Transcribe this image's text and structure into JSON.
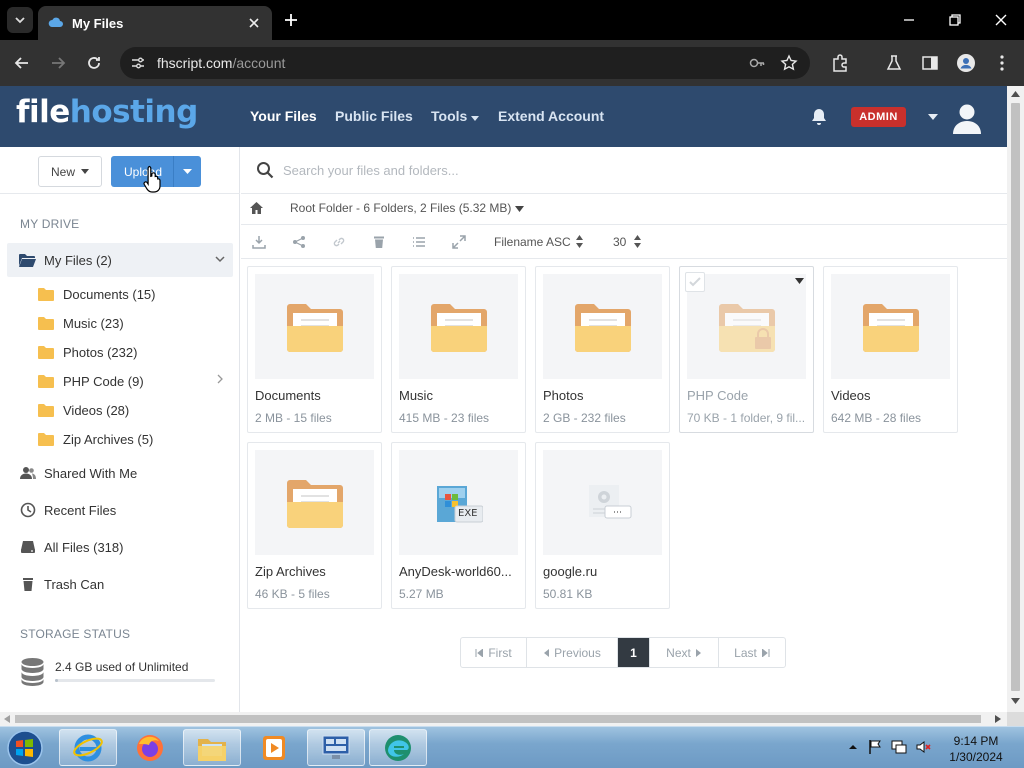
{
  "browser": {
    "tab_title": "My Files",
    "url_host": "fhscript.com",
    "url_path": "/account"
  },
  "header": {
    "logo_part1": "file",
    "logo_part2": "hosting",
    "nav": [
      "Your Files",
      "Public Files",
      "Tools",
      "Extend Account"
    ],
    "admin_badge": "ADMIN"
  },
  "sidebar": {
    "new_label": "New",
    "upload_label": "Upload",
    "my_drive_title": "MY DRIVE",
    "my_files": "My Files (2)",
    "folders": [
      "Documents (15)",
      "Music (23)",
      "Photos (232)",
      "PHP Code (9)",
      "Videos (28)",
      "Zip Archives (5)"
    ],
    "links": [
      "Shared With Me",
      "Recent Files",
      "All Files (318)",
      "Trash Can"
    ],
    "storage_title": "STORAGE STATUS",
    "storage_text": "2.4 GB used of Unlimited"
  },
  "main": {
    "search_placeholder": "Search your files and folders...",
    "breadcrumb": "Root Folder - 6 Folders, 2 Files (5.32 MB)",
    "sort_label": "Filename ASC",
    "per_page": "30",
    "items": [
      {
        "name": "Documents",
        "meta": "2 MB - 15 files",
        "kind": "folder"
      },
      {
        "name": "Music",
        "meta": "415 MB - 23 files",
        "kind": "folder"
      },
      {
        "name": "Photos",
        "meta": "2 GB - 232 files",
        "kind": "folder"
      },
      {
        "name": "PHP Code",
        "meta": "70 KB - 1 folder, 9 fil...",
        "kind": "folder-locked"
      },
      {
        "name": "Videos",
        "meta": "642 MB - 28 files",
        "kind": "folder"
      },
      {
        "name": "Zip Archives",
        "meta": "46 KB - 5 files",
        "kind": "folder"
      },
      {
        "name": "AnyDesk-world60...",
        "meta": "5.27 MB",
        "kind": "exe"
      },
      {
        "name": "google.ru",
        "meta": "50.81 KB",
        "kind": "generic"
      }
    ],
    "exe_badge": "EXE",
    "pagination": {
      "first": "First",
      "previous": "Previous",
      "current": "1",
      "next": "Next",
      "last": "Last"
    }
  },
  "taskbar": {
    "time": "9:14 PM",
    "date": "1/30/2024"
  }
}
